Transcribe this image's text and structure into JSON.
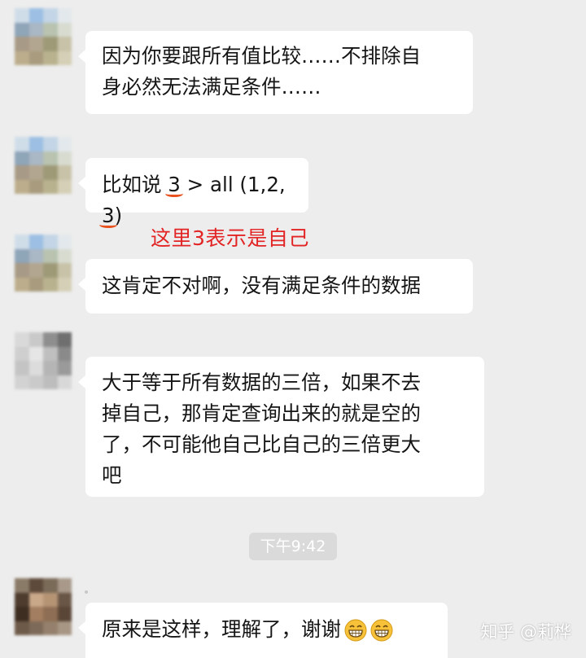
{
  "messages": [
    {
      "lines": [
        "因为你要跟所有值比较……不排除自",
        "身必然无法满足条件……"
      ]
    },
    {
      "prefix": "比如说 ",
      "num1": "3",
      "middle": " > all (1,2,",
      "num2": "3",
      "suffix": ")"
    },
    {
      "lines": [
        "这肯定不对啊，没有满足条件的数据"
      ]
    },
    {
      "lines": [
        "大于等于所有数据的三倍，如果不去",
        "掉自己，那肯定查询出来的就是空的",
        "了，不可能他自己比自己的三倍更大",
        "吧"
      ]
    },
    {
      "text": "原来是这样，理解了，谢谢",
      "emoji": [
        "grinning-face-icon",
        "grinning-face-icon"
      ]
    }
  ],
  "annotation": "这里3表示是自己",
  "timestamp": "下午9:42",
  "watermark": "知乎 @莉桦",
  "colors": {
    "background": "#ededed",
    "bubble": "#ffffff",
    "annotation": "#e22424",
    "underline": "#e8521f",
    "timestamp_bg": "#dadada"
  }
}
